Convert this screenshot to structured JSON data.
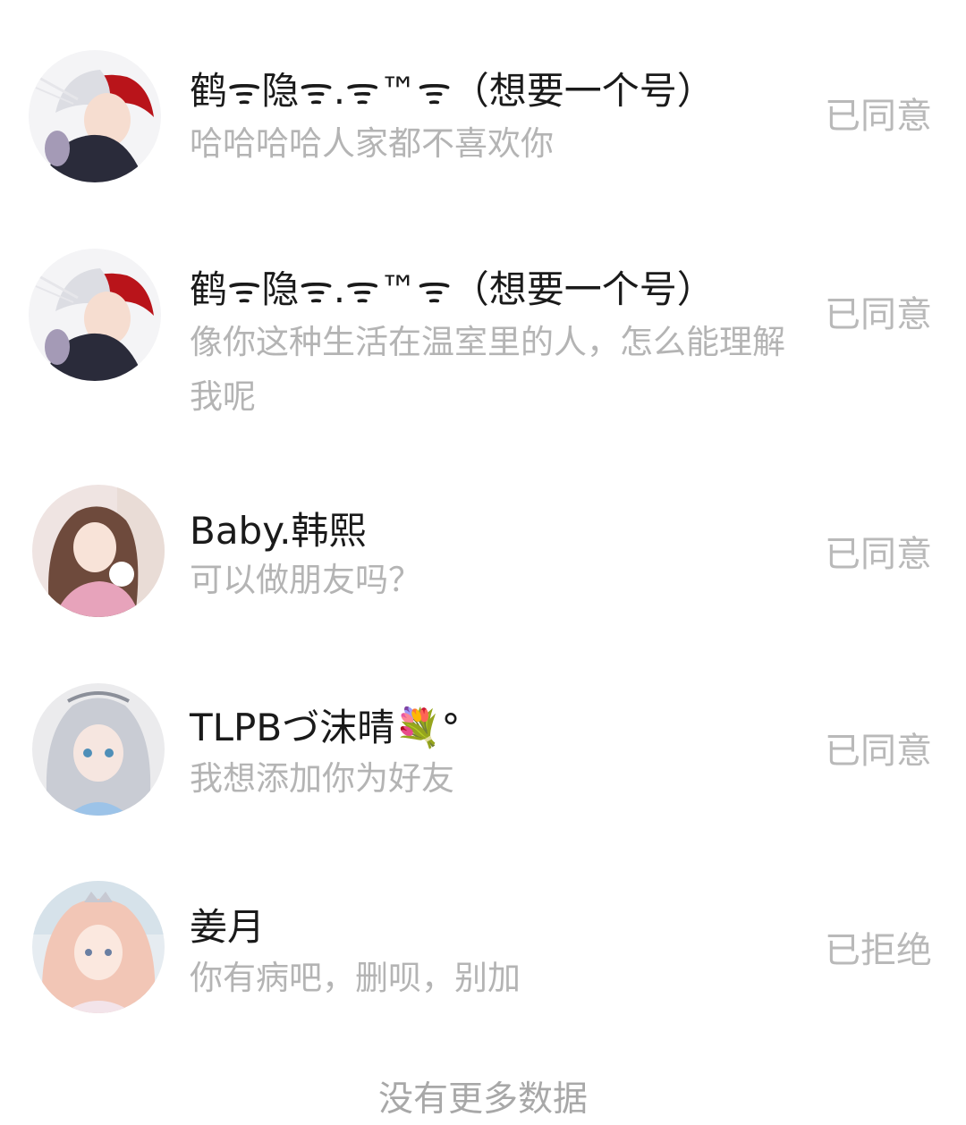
{
  "requests": [
    {
      "name": "鹤ᯤ隐ᯤ.ᯤ™ᯤ（想要一个号）",
      "message": "哈哈哈哈人家都不喜欢你",
      "status": "已同意",
      "avatar": "anime-boy-red-white-hair-avatar"
    },
    {
      "name": "鹤ᯤ隐ᯤ.ᯤ™ᯤ（想要一个号）",
      "message": "像你这种生活在温室里的人，怎么能理解我呢",
      "status": "已同意",
      "avatar": "anime-boy-red-white-hair-avatar"
    },
    {
      "name": "Baby.韩熙",
      "message": "可以做朋友吗？",
      "status": "已同意",
      "avatar": "anime-girl-brown-hair-cat-avatar"
    },
    {
      "name": "TLPBづ沫晴💐°",
      "message": "我想添加你为好友",
      "status": "已同意",
      "avatar": "anime-girl-silver-hair-avatar"
    },
    {
      "name": "姜月",
      "message": "你有病吧，删呗，别加",
      "status": "已拒绝",
      "avatar": "anime-girl-pink-hair-tiara-avatar"
    }
  ],
  "footer": "没有更多数据",
  "colors": {
    "name": "#1a1a1a",
    "message": "#b4b4b4",
    "status": "#b9b9b9",
    "footer": "#a8a8a8"
  }
}
